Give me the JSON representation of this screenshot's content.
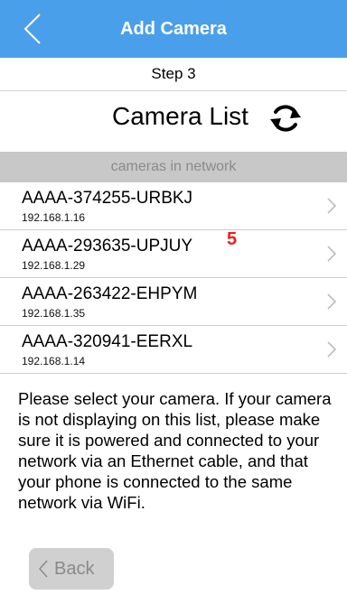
{
  "header": {
    "title": "Add Camera",
    "back_icon": "chevron-left-icon",
    "bg_color": "#4a9fea"
  },
  "step": {
    "label": "Step 3"
  },
  "camera_list": {
    "title": "Camera List",
    "refresh_icon": "refresh-icon",
    "section_label": "cameras in network",
    "items": [
      {
        "name": "AAAA-374255-URBKJ",
        "ip": "192.168.1.16"
      },
      {
        "name": "AAAA-293635-UPJUY",
        "ip": "192.168.1.29"
      },
      {
        "name": "AAAA-263422-EHPYM",
        "ip": "192.168.1.35"
      },
      {
        "name": "AAAA-320941-EERXL",
        "ip": "192.168.1.14"
      }
    ]
  },
  "annotation": {
    "label": "5",
    "color": "#e8201c"
  },
  "instructions": "Please select your camera. If your camera is not displaying on this list, please make sure it is powered and connected to your network via an Ethernet cable, and that your phone is connected to the same network via WiFi.",
  "footer": {
    "back_label": "Back"
  }
}
